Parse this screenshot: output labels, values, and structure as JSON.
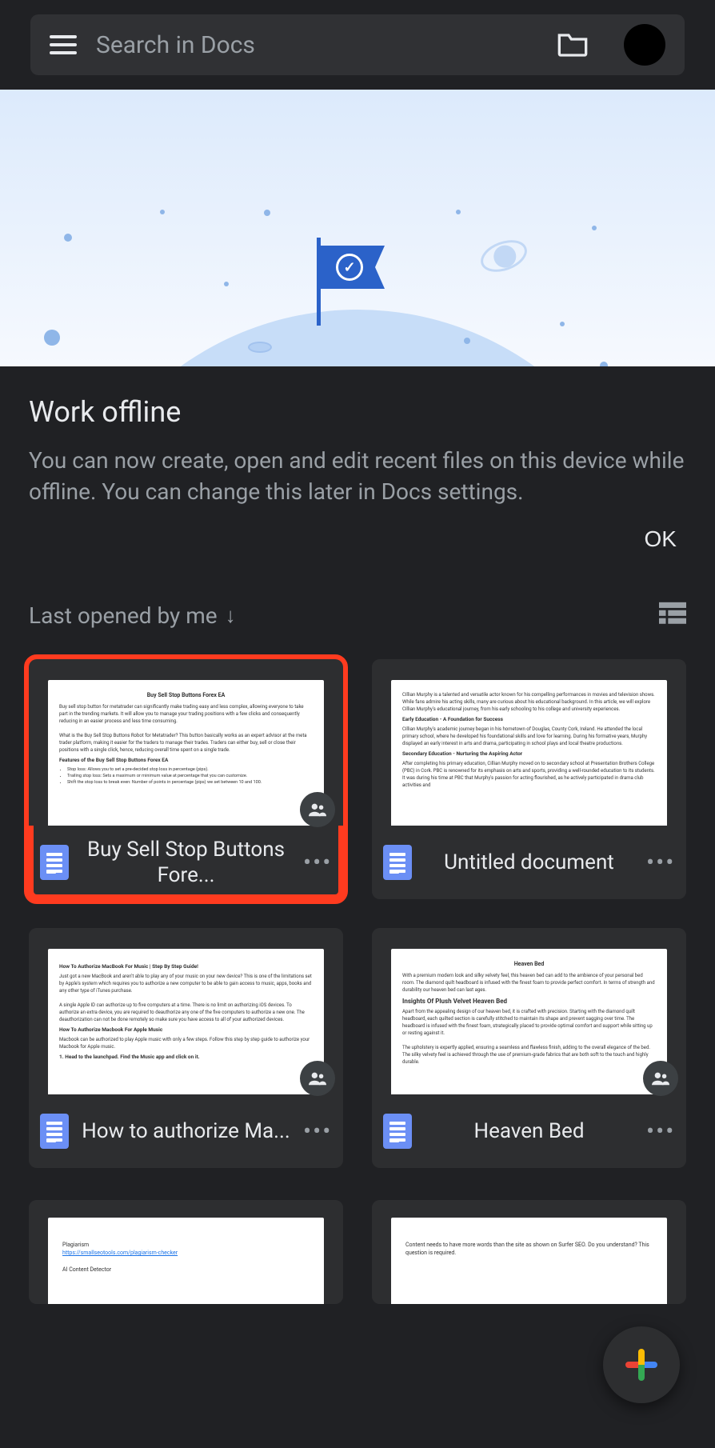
{
  "search": {
    "placeholder": "Search in Docs"
  },
  "info": {
    "title": "Work offline",
    "body": "You can now create, open and edit recent files on this device while offline. You can change this later in Docs settings.",
    "ok": "OK"
  },
  "sort": {
    "label": "Last opened by me"
  },
  "docs": [
    {
      "title": "Buy Sell Stop Buttons Fore...",
      "highlighted": true,
      "shared": true,
      "preview": {
        "heading": "Buy Sell Stop Buttons Forex EA",
        "p1": "Buy sell stop button for metatrader can significantly make trading easy and less complex, allowing everyone to take part in the trending markets. It will allow you to manage your trading positions with a few clicks and consequently reducing in an easier process and less time consuming.",
        "p2": "What is the Buy Sell Stop Buttons Robot for Metatrader? This button basically works as an expert advisor at the meta trader platform, making it easier for the traders to manage their trades. Traders can either buy, sell or close their positions with a single click, hence, reducing overall time spent on a single trade.",
        "sub": "Features of the Buy Sell Stop Buttons Forex EA",
        "bullets": [
          "Stop loss: Allows you to set a pre-decided stop loss in percentage (pips).",
          "Trailing stop loss: Sets a maximum or minimum value at percentage that you can customize.",
          "Shift the stop loss to break even: Number of points in percentage (pips) we set between 10 and 100."
        ]
      }
    },
    {
      "title": "Untitled document",
      "highlighted": false,
      "shared": false,
      "preview": {
        "p1": "Cillian Murphy is a talented and versatile actor known for his compelling performances in movies and television shows. While fans admire his acting skills, many are curious about his educational background. In this article, we will explore Cillian Murphy's educational journey, from his early schooling to his college and university experiences.",
        "sub1": "Early Education - A Foundation for Success",
        "p2": "Cillian Murphy's academic journey began in his hometown of Douglas, County Cork, Ireland. He attended the local primary school, where he developed his foundational skills and love for learning. During his formative years, Murphy displayed an early interest in arts and drama, participating in school plays and local theatre productions.",
        "sub2": "Secondary Education - Nurturing the Aspiring Actor",
        "p3": "After completing his primary education, Cillian Murphy moved on to secondary school at Presentation Brothers College (PBC) in Cork. PBC is renowned for its emphasis on arts and sports, providing a well-rounded education to its students. It was during his time at PBC that Murphy's passion for acting flourished, as he actively participated in drama club activities and"
      }
    },
    {
      "title": "How to authorize Ma...",
      "highlighted": false,
      "shared": true,
      "preview": {
        "heading": "How To Authorize MacBook For Music | Step By Step Guide!",
        "p1": "Just got a new MacBook and aren't able to play any of your music on your new device? This is one of the limitations set by Apple's system which requires you to authorize a new computer to be able to gain access to music, apps, books and any other type of iTunes purchase.",
        "p2": "A single Apple ID can authorize up to five computers at a time. There is no limit on authorizing iOS devices. To authorize an extra device, you are required to deauthorize any one of the five computers to authorize a new one. The deauthorization can not be done remotely so make sure you have access to all of your authorized devices.",
        "sub": "How To Authorize Macbook For Apple Music",
        "p3": "Macbook can be authorized to play Apple music with only a few steps. Follow this step by step guide to authorize your Macbook for Apple music.",
        "step": "1. Head to the launchpad. Find the Music app and click on it."
      }
    },
    {
      "title": "Heaven Bed",
      "highlighted": false,
      "shared": true,
      "preview": {
        "heading": "Heaven Bed",
        "p1": "With a premium modern look and silky velvety feel, this heaven bed can add to the ambience of your personal bed room. The diamond quilt headboard is infused with the finest foam to provide perfect comfort. In terms of strength and durability our heaven bed can last ages.",
        "sub": "Insights Of Plush Velvet Heaven Bed",
        "p2": "Apart from the appealing design of our heaven bed, it is crafted with precision. Starting with the diamond quilt headboard, each quilted section is carefully stitched to maintain its shape and prevent sagging over time. The headboard is infused with the finest foam, strategically placed to provide optimal comfort and support while sitting up or resting against it.",
        "p3": "The upholstery is expertly applied, ensuring a seamless and flawless finish, adding to the overall elegance of the bed. The silky velvety feel is achieved through the use of premium-grade fabrics that are both soft to the touch and highly durable."
      }
    },
    {
      "title": "",
      "highlighted": false,
      "shared": false,
      "preview": {
        "heading": "Plagiarism",
        "link": "https://smallseotools.com/plagiarism-checker",
        "sub": "AI Content Detector"
      }
    },
    {
      "title": "",
      "highlighted": false,
      "shared": false,
      "preview": {
        "p1": "Content needs to have more words than the site as shown on Surfer SEO. Do you understand? This question is required."
      }
    }
  ]
}
